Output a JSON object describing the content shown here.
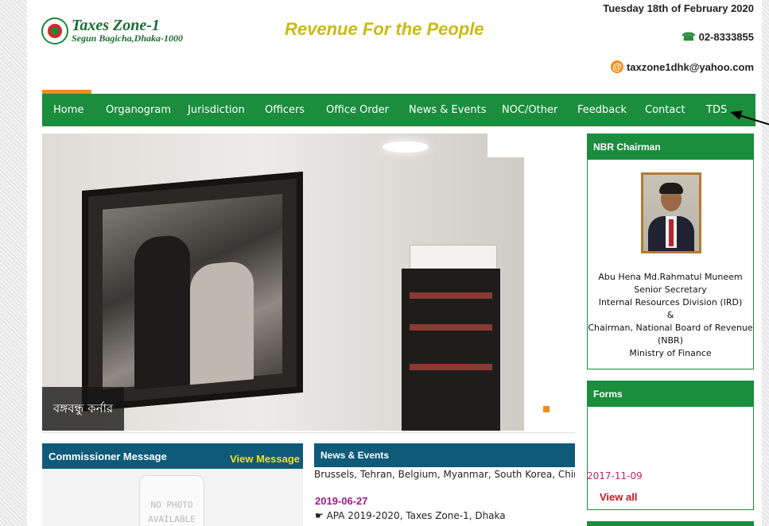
{
  "header": {
    "site_title": "Taxes Zone-1",
    "site_subtitle": "Segun Bagicha,Dhaka-1000",
    "tagline": "Revenue For the People",
    "date": "Tuesday 18th of February 2020",
    "phone": "02-8333855",
    "email": "taxzone1dhk@yahoo.com",
    "icons": {
      "logo": "govt-seal-logo",
      "phone": "phone-icon",
      "email": "at-icon"
    }
  },
  "nav": {
    "items": [
      "Home",
      "Organogram",
      "Jurisdiction",
      "Officers",
      "Office Order",
      "News & Events",
      "NOC/Other",
      "Feedback",
      "Contact",
      "TDS"
    ],
    "active_index": 0
  },
  "slider": {
    "caption": "বঙ্গবন্ধু কর্নার",
    "shelf_sign": "বঙ্গবন্ধু কর্নার"
  },
  "sidebar": {
    "nbr": {
      "title": "NBR Chairman",
      "lines": [
        "Abu Hena Md.Rahmatul Muneem",
        "Senior Secretary",
        "Internal Resources Division (IRD)",
        "&",
        "Chairman, National Board of Revenue",
        "(NBR)",
        "Ministry of Finance"
      ]
    },
    "forms": {
      "title": "Forms",
      "date": "2017-11-09",
      "view_all": "View all"
    }
  },
  "commissioner": {
    "title": "Commissioner Message",
    "view_label": "View Message",
    "photo_placeholder_1": "NO PHOTO",
    "photo_placeholder_2": "AVAILABLE"
  },
  "news": {
    "title": "News & Events",
    "ticker": "Brussels, Tehran, Belgium, Myanmar, South Korea, China, USA",
    "date": "2019-06-27",
    "item": "APA 2019-2020, Taxes Zone-1, Dhaka"
  },
  "colors": {
    "nav_green": "#1b8d3c",
    "accent_orange": "#f28c1a",
    "tagline_yellow": "#c9bb10",
    "panel_blue": "#0e5a78"
  }
}
